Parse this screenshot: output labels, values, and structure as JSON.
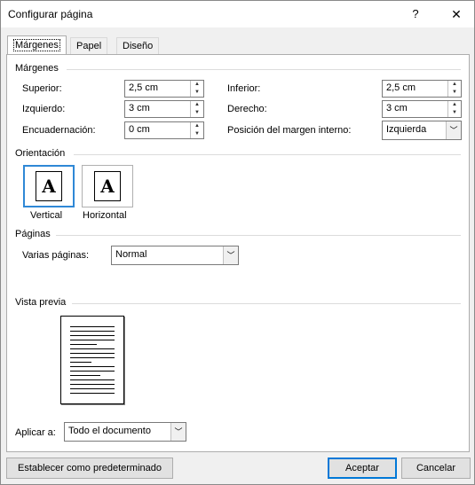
{
  "window": {
    "title": "Configurar página",
    "help_label": "?",
    "close_label": "✕"
  },
  "tabs": [
    {
      "label": "Márgenes",
      "active": true
    },
    {
      "label": "Papel",
      "active": false
    },
    {
      "label": "Diseño",
      "active": false
    }
  ],
  "margins": {
    "group_title": "Márgenes",
    "top": {
      "label": "Superior:",
      "value": "2,5 cm"
    },
    "bottom": {
      "label": "Inferior:",
      "value": "2,5 cm"
    },
    "left": {
      "label": "Izquierdo:",
      "value": "3 cm"
    },
    "right": {
      "label": "Derecho:",
      "value": "3 cm"
    },
    "gutter": {
      "label": "Encuadernación:",
      "value": "0 cm"
    },
    "gutter_position": {
      "label": "Posición del margen interno:",
      "value": "Izquierda"
    }
  },
  "orientation": {
    "group_title": "Orientación",
    "portrait": {
      "label": "Vertical",
      "glyph": "A",
      "selected": true
    },
    "landscape": {
      "label": "Horizontal",
      "glyph": "A",
      "selected": false
    }
  },
  "pages": {
    "group_title": "Páginas",
    "multiple_pages_label": "Varias páginas:",
    "multiple_pages_value": "Normal"
  },
  "preview": {
    "group_title": "Vista previa"
  },
  "apply_to": {
    "label": "Aplicar a:",
    "value": "Todo el documento"
  },
  "buttons": {
    "set_default": "Establecer como predeterminado",
    "ok": "Aceptar",
    "cancel": "Cancelar"
  },
  "icons": {
    "spin_up": "triangle-up-icon",
    "spin_down": "triangle-down-icon",
    "dropdown": "chevron-down-icon"
  },
  "colors": {
    "selection_border": "#2f88d6",
    "default_button_border": "#0078d7"
  }
}
